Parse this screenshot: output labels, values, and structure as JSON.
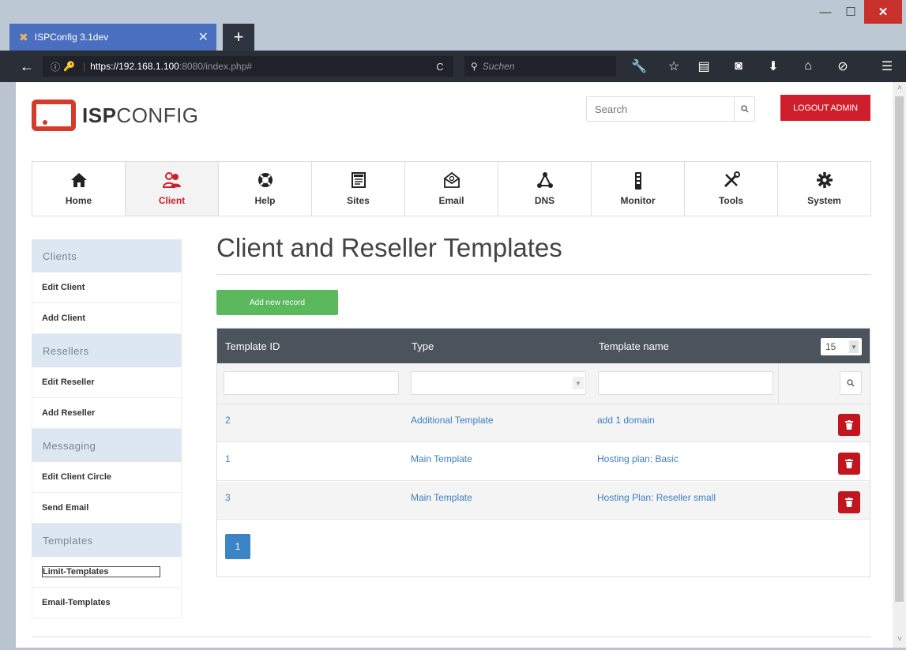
{
  "browser": {
    "tab_title": "ISPConfig 3.1dev",
    "tab_close": "✕",
    "new_tab": "+",
    "url_host": "https://192.168.1.100",
    "url_rest": ":8080/index.php#",
    "search_placeholder": "Suchen",
    "window_controls": {
      "minimize": "—",
      "maximize": "☐",
      "close": "✕"
    }
  },
  "header": {
    "logo_bold": "ISP",
    "logo_rest": "CONFIG",
    "search_placeholder": "Search",
    "logout_label": "LOGOUT ADMIN"
  },
  "mainnav": {
    "items": [
      {
        "label": "Home",
        "icon": "home-icon",
        "active": false
      },
      {
        "label": "Client",
        "icon": "users-icon",
        "active": true
      },
      {
        "label": "Help",
        "icon": "lifebuoy-icon",
        "active": false
      },
      {
        "label": "Sites",
        "icon": "sites-icon",
        "active": false
      },
      {
        "label": "Email",
        "icon": "envelope-icon",
        "active": false
      },
      {
        "label": "DNS",
        "icon": "network-icon",
        "active": false
      },
      {
        "label": "Monitor",
        "icon": "monitor-icon",
        "active": false
      },
      {
        "label": "Tools",
        "icon": "tools-icon",
        "active": false
      },
      {
        "label": "System",
        "icon": "gear-icon",
        "active": false
      }
    ]
  },
  "sidebar": {
    "sections": [
      {
        "heading": "Clients",
        "items": [
          "Edit Client",
          "Add Client"
        ]
      },
      {
        "heading": "Resellers",
        "items": [
          "Edit Reseller",
          "Add Reseller"
        ]
      },
      {
        "heading": "Messaging",
        "items": [
          "Edit Client Circle",
          "Send Email"
        ]
      },
      {
        "heading": "Templates",
        "items": [
          "Limit-Templates",
          "Email-Templates"
        ]
      }
    ],
    "selected": "Limit-Templates"
  },
  "main": {
    "title": "Client and Reseller Templates",
    "add_button": "Add new record",
    "table": {
      "columns": [
        "Template ID",
        "Type",
        "Template name"
      ],
      "per_page": "15",
      "rows": [
        {
          "id": "2",
          "type": "Additional Template",
          "name": "add 1 domain"
        },
        {
          "id": "1",
          "type": "Main Template",
          "name": "Hosting plan: Basic"
        },
        {
          "id": "3",
          "type": "Main Template",
          "name": "Hosting Plan: Reseller small"
        }
      ]
    },
    "pager": {
      "current_page": "1"
    }
  },
  "colors": {
    "accent_red": "#d01f2c",
    "delete_red": "#c2161f",
    "add_green": "#5cb85c",
    "link_blue": "#3d7fc1",
    "table_header": "#4b535c",
    "sidebar_heading_bg": "#dde7f2"
  }
}
